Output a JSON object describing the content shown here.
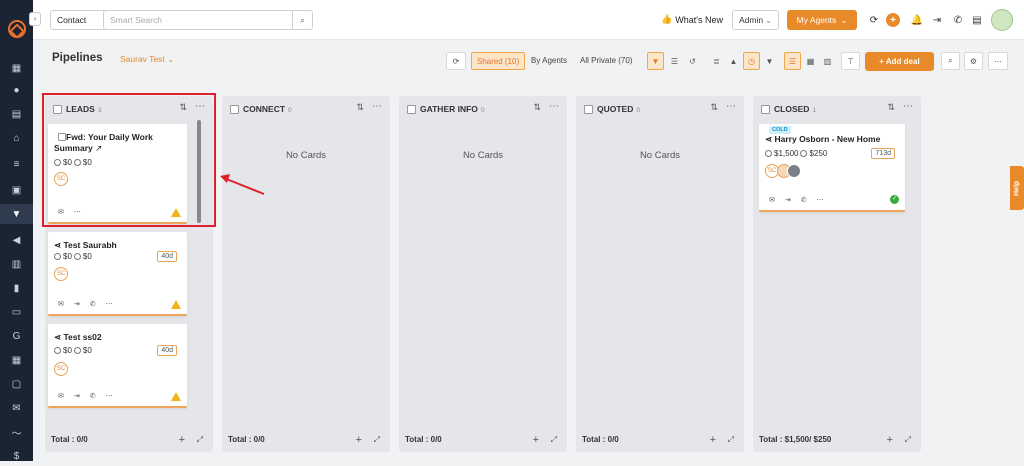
{
  "topbar": {
    "contact_select": "Contact",
    "search_placeholder": "Smart Search",
    "whats_new": "What's New",
    "role_select": "Admin",
    "agents_button": "My Agents"
  },
  "pipeline": {
    "title": "Pipelines",
    "user_select": "Saurav Test",
    "shared": "Shared (10)",
    "by_agents": "By Agents",
    "all_private": "All Private (70)",
    "add_deal": "+ Add deal"
  },
  "columns": [
    {
      "name": "LEADS",
      "count": "3",
      "total": "Total : 0/0"
    },
    {
      "name": "CONNECT",
      "count": "0",
      "total": "Total : 0/0",
      "empty": "No Cards"
    },
    {
      "name": "GATHER INFO",
      "count": "0",
      "total": "Total : 0/0",
      "empty": "No Cards"
    },
    {
      "name": "QUOTED",
      "count": "0",
      "total": "Total : 0/0",
      "empty": "No Cards"
    },
    {
      "name": "CLOSED",
      "count": "1",
      "total": "Total : $1,500/ $250"
    }
  ],
  "cards": [
    {
      "title_line1": "Fwd: Your Daily Work",
      "title_line2": "Summary",
      "value1": "$0",
      "value2": "$0",
      "avatar": "SC"
    },
    {
      "title": "Test Saurabh",
      "value1": "$0",
      "value2": "$0",
      "age": "40d",
      "avatar": "SC"
    },
    {
      "title": "Test ss02",
      "value1": "$0",
      "value2": "$0",
      "age": "40d",
      "avatar": "SC"
    },
    {
      "badge": "COLD",
      "title": "Harry Osborn - New Home",
      "value1": "$1,500",
      "value2": "$250",
      "age": "713d",
      "avatar": "SC"
    }
  ],
  "help": "Help",
  "colors": {
    "accent": "#e8892a",
    "sidebar": "#1b2433",
    "highlight": "#e0202a"
  }
}
